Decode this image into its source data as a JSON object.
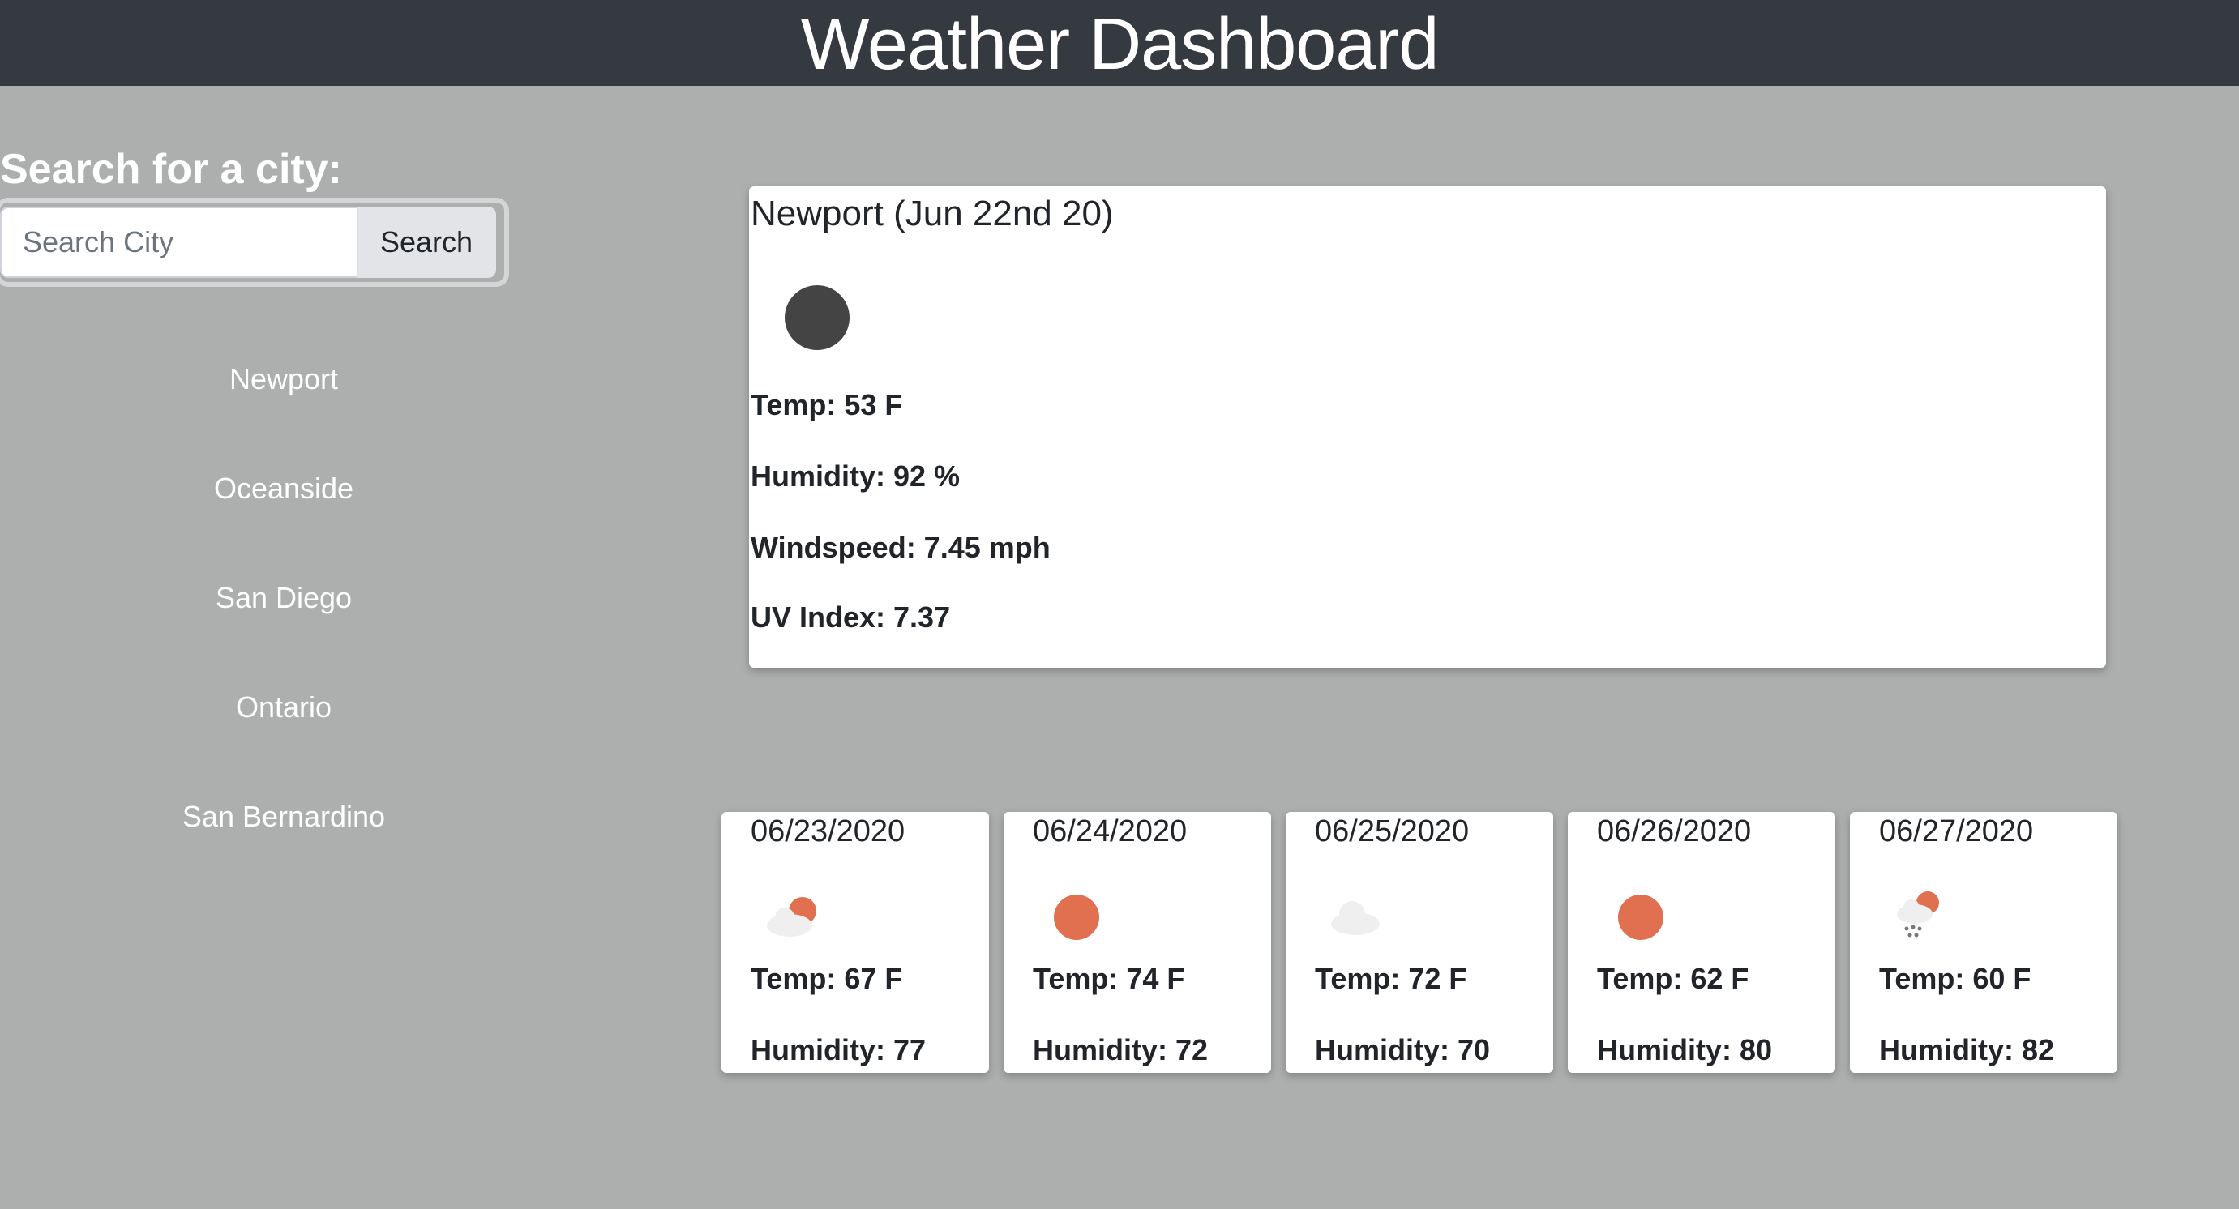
{
  "header": {
    "title": "Weather Dashboard"
  },
  "search": {
    "heading": "Search for a city:",
    "placeholder": "Search City",
    "button_label": "Search"
  },
  "cities": [
    "Newport",
    "Oceanside",
    "San Diego",
    "Ontario",
    "San Bernardino"
  ],
  "current": {
    "title": "Newport (Jun 22nd 20)",
    "icon": "moon-night-icon",
    "temp": "Temp: 53 F",
    "humidity": "Humidity: 92 %",
    "windspeed": "Windspeed: 7.45 mph",
    "uv_index": "UV Index: 7.37"
  },
  "forecast": [
    {
      "date": "06/23/2020",
      "icon": "partly-cloudy-icon",
      "temp": "Temp: 67 F",
      "humidity": "Humidity: 77"
    },
    {
      "date": "06/24/2020",
      "icon": "sun-icon",
      "temp": "Temp: 74 F",
      "humidity": "Humidity: 72"
    },
    {
      "date": "06/25/2020",
      "icon": "cloud-icon",
      "temp": "Temp: 72 F",
      "humidity": "Humidity: 70"
    },
    {
      "date": "06/26/2020",
      "icon": "sun-icon",
      "temp": "Temp: 62 F",
      "humidity": "Humidity: 80"
    },
    {
      "date": "06/27/2020",
      "icon": "rain-sun-icon",
      "temp": "Temp: 60 F",
      "humidity": "Humidity: 82"
    }
  ],
  "colors": {
    "header_bg": "#343a40",
    "page_bg": "#adafae",
    "sun": "#e0704f",
    "moon": "#444444",
    "cloud": "#eeeeee"
  }
}
